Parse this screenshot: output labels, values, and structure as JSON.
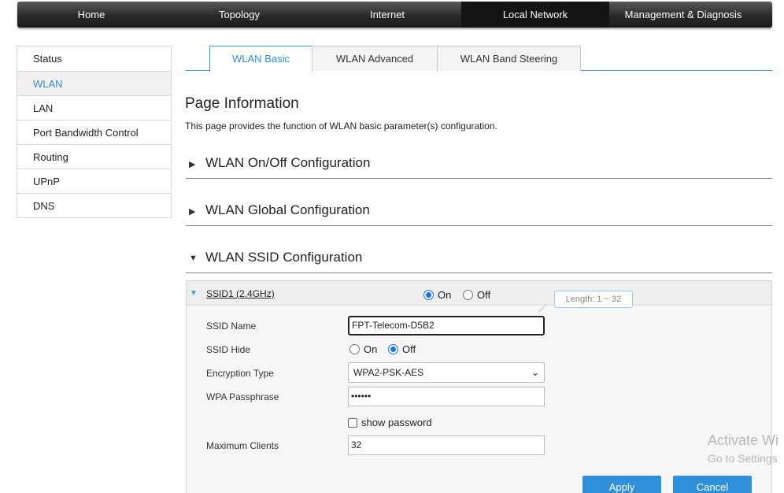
{
  "topnav": {
    "items": [
      {
        "label": "Home"
      },
      {
        "label": "Topology"
      },
      {
        "label": "Internet"
      },
      {
        "label": "Local Network"
      },
      {
        "label": "Management & Diagnosis"
      }
    ],
    "active": "Local Network"
  },
  "sidebar": {
    "items": [
      {
        "label": "Status"
      },
      {
        "label": "WLAN"
      },
      {
        "label": "LAN"
      },
      {
        "label": "Port Bandwidth Control"
      },
      {
        "label": "Routing"
      },
      {
        "label": "UPnP"
      },
      {
        "label": "DNS"
      }
    ],
    "active": "WLAN"
  },
  "tabs": [
    {
      "label": "WLAN Basic"
    },
    {
      "label": "WLAN Advanced"
    },
    {
      "label": "WLAN Band Steering"
    }
  ],
  "active_tab": "WLAN Basic",
  "page": {
    "title": "Page Information",
    "description": "This page provides the function of WLAN basic parameter(s) configuration."
  },
  "sections": {
    "onoff": "WLAN On/Off Configuration",
    "global": "WLAN Global Configuration",
    "ssid": "WLAN SSID Configuration"
  },
  "ssid_panel": {
    "ssid_label": "SSID1 (2.4GHz)",
    "enable_on": "On",
    "enable_off": "Off",
    "enable_selected": "On",
    "tooltip": "Length: 1 ~ 32",
    "fields": {
      "ssid_name_label": "SSID Name",
      "ssid_name_value": "FPT-Telecom-D5B2",
      "ssid_hide_label": "SSID Hide",
      "hide_on": "On",
      "hide_off": "Off",
      "hide_selected": "Off",
      "encryption_label": "Encryption Type",
      "encryption_value": "WPA2-PSK-AES",
      "passphrase_label": "WPA Passphrase",
      "passphrase_value": "••••••",
      "show_password": "show password",
      "show_password_checked": false,
      "max_clients_label": "Maximum Clients",
      "max_clients_value": "32"
    },
    "apply": "Apply",
    "cancel": "Cancel"
  },
  "watermark": {
    "line1": "Activate Wi",
    "line2": "Go to Settings"
  },
  "colors": {
    "accent": "#2f8fd8",
    "nav_bg": "#2a2a2a",
    "radio_checked": "#1a73e8"
  }
}
